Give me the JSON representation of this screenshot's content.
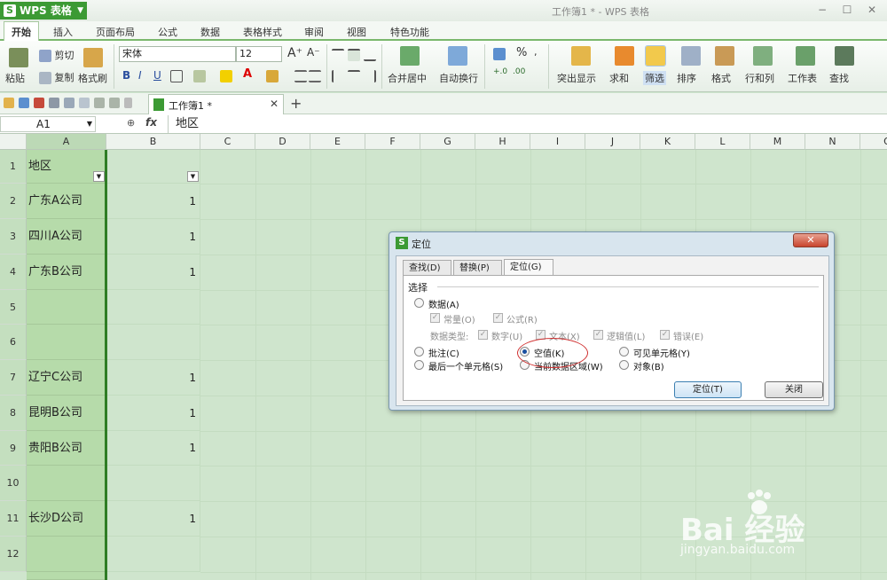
{
  "app": {
    "name": "WPS 表格",
    "logo": "S",
    "window_title": "工作簿1 * - WPS 表格"
  },
  "menu": [
    "开始",
    "插入",
    "页面布局",
    "公式",
    "数据",
    "表格样式",
    "审阅",
    "视图",
    "特色功能"
  ],
  "ribbon": {
    "paste": "粘贴",
    "cut": "剪切",
    "copy": "复制",
    "format_painter": "格式刷",
    "font": "宋体",
    "font_size": "12",
    "merge": "合并居中",
    "wrap": "自动换行",
    "number_format": "%",
    "highlight": "突出显示",
    "sum": "求和",
    "filter": "筛选",
    "sort": "排序",
    "format": "格式",
    "rowcol": "行和列",
    "sheet": "工作表",
    "find": "查找"
  },
  "doc_tab": "工作簿1 *",
  "formula": {
    "cell": "A1",
    "fx": "fx",
    "value": "地区"
  },
  "columns": [
    "A",
    "B",
    "C",
    "D",
    "E",
    "F",
    "G",
    "H",
    "I",
    "J",
    "K",
    "L",
    "M",
    "N",
    "O"
  ],
  "rows": [
    {
      "num": "1",
      "a": "地区",
      "b": ""
    },
    {
      "num": "2",
      "a": "广东A公司",
      "b": "1"
    },
    {
      "num": "3",
      "a": "四川A公司",
      "b": "1"
    },
    {
      "num": "4",
      "a": "广东B公司",
      "b": "1"
    },
    {
      "num": "5",
      "a": "",
      "b": ""
    },
    {
      "num": "6",
      "a": "",
      "b": ""
    },
    {
      "num": "7",
      "a": "辽宁C公司",
      "b": "1"
    },
    {
      "num": "8",
      "a": "昆明B公司",
      "b": "1"
    },
    {
      "num": "9",
      "a": "贵阳B公司",
      "b": "1"
    },
    {
      "num": "10",
      "a": "",
      "b": ""
    },
    {
      "num": "11",
      "a": "长沙D公司",
      "b": "1"
    },
    {
      "num": "12",
      "a": "",
      "b": ""
    }
  ],
  "dialog": {
    "title": "定位",
    "close": "✕",
    "tabs": [
      "查找(D)",
      "替换(P)",
      "定位(G)"
    ],
    "group": "选择",
    "data": "数据(A)",
    "constant": "常量(O)",
    "formula": "公式(R)",
    "type_label": "数据类型:",
    "number": "数字(U)",
    "text": "文本(X)",
    "logical": "逻辑值(L)",
    "error": "错误(E)",
    "comment": "批注(C)",
    "blank": "空值(K)",
    "visible": "可见单元格(Y)",
    "last_cell": "最后一个单元格(S)",
    "current_region": "当前数据区域(W)",
    "object": "对象(B)",
    "ok": "定位(T)",
    "cancel": "关闭"
  },
  "watermark": {
    "brand": "Bai 经验",
    "url": "jingyan.baidu.com"
  }
}
